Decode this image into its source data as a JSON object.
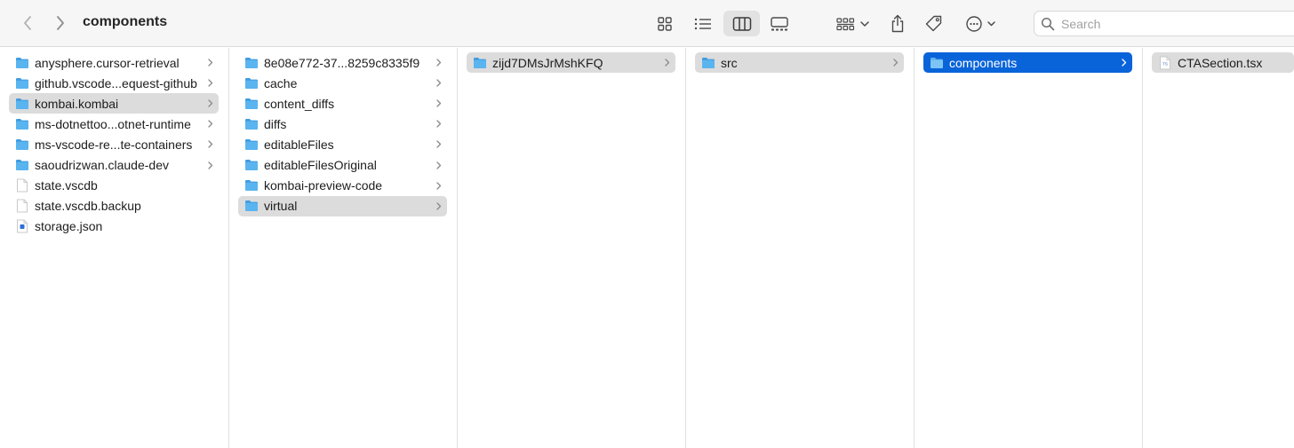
{
  "window": {
    "title": "components"
  },
  "toolbar": {
    "back_icon": "chevron-left-icon",
    "forward_icon": "chevron-right-icon",
    "views": [
      "icons-view-icon",
      "list-view-icon",
      "columns-view-icon",
      "gallery-view-icon"
    ],
    "active_view": "columns",
    "group_icon": "group-by-icon",
    "share_icon": "share-icon",
    "tag_icon": "tag-icon",
    "more_icon": "more-actions-icon"
  },
  "search": {
    "placeholder": "Search",
    "value": ""
  },
  "colors": {
    "selection_blue": "#0a64d9",
    "selection_gray": "#dcdcdc",
    "folder_blue": "#4aa8e8"
  },
  "columns": [
    {
      "items": [
        {
          "label": "anysphere.cursor-retrieval",
          "kind": "folder",
          "expandable": true,
          "selected": ""
        },
        {
          "label": "github.vscode...equest-github",
          "kind": "folder",
          "expandable": true,
          "selected": ""
        },
        {
          "label": "kombai.kombai",
          "kind": "folder",
          "expandable": true,
          "selected": "gray"
        },
        {
          "label": "ms-dotnettoo...otnet-runtime",
          "kind": "folder",
          "expandable": true,
          "selected": ""
        },
        {
          "label": "ms-vscode-re...te-containers",
          "kind": "folder",
          "expandable": true,
          "selected": ""
        },
        {
          "label": "saoudrizwan.claude-dev",
          "kind": "folder",
          "expandable": true,
          "selected": ""
        },
        {
          "label": "state.vscdb",
          "kind": "file",
          "expandable": false,
          "selected": ""
        },
        {
          "label": "state.vscdb.backup",
          "kind": "file",
          "expandable": false,
          "selected": ""
        },
        {
          "label": "storage.json",
          "kind": "json",
          "expandable": false,
          "selected": ""
        }
      ]
    },
    {
      "items": [
        {
          "label": "8e08e772-37...8259c8335f9",
          "kind": "folder",
          "expandable": true,
          "selected": ""
        },
        {
          "label": "cache",
          "kind": "folder",
          "expandable": true,
          "selected": ""
        },
        {
          "label": "content_diffs",
          "kind": "folder",
          "expandable": true,
          "selected": ""
        },
        {
          "label": "diffs",
          "kind": "folder",
          "expandable": true,
          "selected": ""
        },
        {
          "label": "editableFiles",
          "kind": "folder",
          "expandable": true,
          "selected": ""
        },
        {
          "label": "editableFilesOriginal",
          "kind": "folder",
          "expandable": true,
          "selected": ""
        },
        {
          "label": "kombai-preview-code",
          "kind": "folder",
          "expandable": true,
          "selected": ""
        },
        {
          "label": "virtual",
          "kind": "folder",
          "expandable": true,
          "selected": "gray"
        }
      ]
    },
    {
      "items": [
        {
          "label": "zijd7DMsJrMshKFQ",
          "kind": "folder",
          "expandable": true,
          "selected": "gray"
        }
      ]
    },
    {
      "items": [
        {
          "label": "src",
          "kind": "folder",
          "expandable": true,
          "selected": "gray"
        }
      ]
    },
    {
      "items": [
        {
          "label": "components",
          "kind": "folder",
          "expandable": true,
          "selected": "blue"
        }
      ]
    },
    {
      "items": [
        {
          "label": "CTASection.tsx",
          "kind": "ts",
          "expandable": false,
          "selected": "gray"
        }
      ]
    }
  ]
}
